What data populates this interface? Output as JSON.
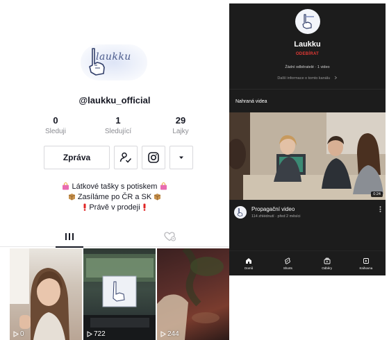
{
  "tiktok": {
    "avatar_logo_text": "laukku",
    "handle": "@laukku_official",
    "stats": [
      {
        "value": "0",
        "label": "Sleduji"
      },
      {
        "value": "1",
        "label": "Sledující"
      },
      {
        "value": "29",
        "label": "Lajky"
      }
    ],
    "message_button": "Zpráva",
    "bio_lines": [
      "Látkové tašky s potiskem",
      "Zasíláme po ČR a SK",
      "Právě v prodeji"
    ],
    "videos": [
      {
        "views": "0"
      },
      {
        "views": "722"
      },
      {
        "views": "244"
      }
    ]
  },
  "youtube": {
    "channel_name": "Laukku",
    "subscribe_label": "ODEBÍRAT",
    "meta": "Žádní odběratelé · 1 video",
    "more_info": "Další informace o tomto kanálu",
    "section_title": "Nahraná videa",
    "video": {
      "duration": "0:24",
      "title": "Propagační video",
      "meta": "114 zhlédnutí · před 2 měsíci"
    },
    "nav": [
      {
        "label": "Domů",
        "icon": "home-icon"
      },
      {
        "label": "Shorts",
        "icon": "shorts-icon"
      },
      {
        "label": "Odběry",
        "icon": "subscriptions-icon"
      },
      {
        "label": "Knihovna",
        "icon": "library-icon"
      }
    ]
  },
  "colors": {
    "tiktok_text": "#161823",
    "tiktok_muted": "#8a8b91",
    "youtube_bg": "#1c1c1c",
    "youtube_red": "#e53935"
  }
}
